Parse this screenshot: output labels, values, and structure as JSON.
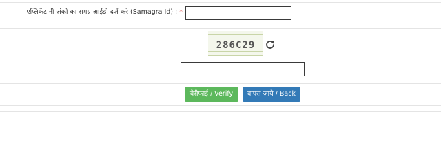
{
  "form": {
    "samagra_label": "एप्लिकेंट नी अंको का समग्र आईडी दर्ज करे (Samagra Id) :",
    "required_marker": "*",
    "samagra_value": "",
    "captcha_text": "286C29",
    "captcha_value": ""
  },
  "icons": {
    "refresh": "refresh-icon"
  },
  "buttons": {
    "verify_label": "वेरीफाई / Verify",
    "back_label": "वापस जाये / Back"
  },
  "colors": {
    "verify_button": "#5cb85c",
    "back_button": "#337ab7",
    "required_marker": "#d9534f"
  }
}
